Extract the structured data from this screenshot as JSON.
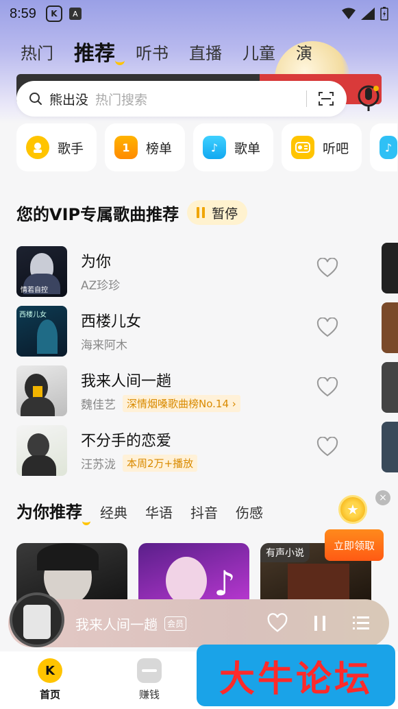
{
  "status": {
    "time": "8:59",
    "app_badge": "A"
  },
  "tabs": [
    {
      "label": "热门"
    },
    {
      "label": "推荐",
      "active": true
    },
    {
      "label": "听书"
    },
    {
      "label": "直播"
    },
    {
      "label": "儿童"
    },
    {
      "label": "演"
    }
  ],
  "search": {
    "keyword": "熊出没",
    "placeholder": "热门搜索"
  },
  "quick_entries": [
    {
      "label": "歌手",
      "icon": "singer-icon"
    },
    {
      "label": "榜单",
      "icon": "chart-rank-icon",
      "glyph": "1"
    },
    {
      "label": "歌单",
      "icon": "playlist-icon",
      "glyph": "♪"
    },
    {
      "label": "听吧",
      "icon": "radio-icon"
    }
  ],
  "vip": {
    "title": "您的VIP专属歌曲推荐",
    "pause_label": "暂停",
    "songs": [
      {
        "name": "为你",
        "artist": "AZ珍珍",
        "tag": "",
        "cover_text": "情若自控"
      },
      {
        "name": "西楼儿女",
        "artist": "海来阿木",
        "tag": "",
        "cover_text": "西楼儿女"
      },
      {
        "name": "我来人间一趟",
        "artist": "魏佳艺",
        "tag": "深情烟嗓歌曲榜No.14 ›",
        "cover_text": ""
      },
      {
        "name": "不分手的恋爱",
        "artist": "汪苏泷",
        "tag": "本周2万+播放",
        "cover_text": ""
      }
    ]
  },
  "recommend": {
    "title": "为你推荐",
    "categories": [
      "经典",
      "华语",
      "抖音",
      "伤感"
    ],
    "cards": [
      {
        "badge": ""
      },
      {
        "badge": ""
      },
      {
        "badge": "有声小说"
      }
    ]
  },
  "reward": {
    "button": "立即领取",
    "close": "×"
  },
  "player": {
    "title": "我来人间一趟",
    "badge": "会员"
  },
  "nav": [
    {
      "label": "首页",
      "active": true
    },
    {
      "label": "赚钱"
    }
  ],
  "watermark": "大牛论坛",
  "colors": {
    "accent": "#ffc400",
    "tag_text": "#d98a00",
    "reward": "#ff5a14"
  }
}
